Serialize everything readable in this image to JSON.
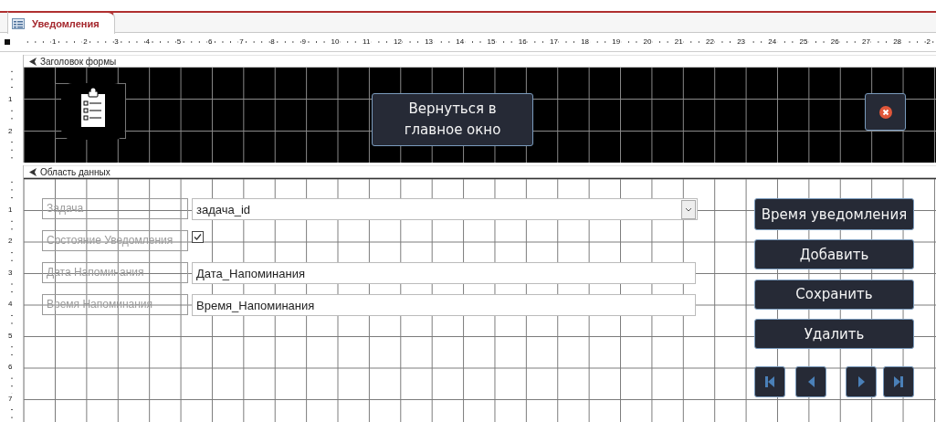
{
  "document_tab": {
    "title": "Уведомления",
    "selected": true
  },
  "ruler": {
    "horizontal": [
      "1",
      "2",
      "3",
      "4",
      "5",
      "6",
      "7",
      "8",
      "9",
      "10",
      "11",
      "12",
      "13",
      "14",
      "15",
      "16",
      "17",
      "18",
      "19",
      "20",
      "21",
      "22",
      "23",
      "24",
      "25",
      "26",
      "27",
      "28",
      "2"
    ],
    "vertical_header": [
      "1",
      "2"
    ],
    "vertical_detail": [
      "1",
      "2",
      "3",
      "4",
      "5",
      "6",
      "7"
    ]
  },
  "header": {
    "section_title": "Заголовок формы",
    "controls": [
      {
        "kind": "logo"
      },
      {
        "kind": "button",
        "label": "Вернуться в главное окно"
      },
      {
        "kind": "close"
      }
    ]
  },
  "detail": {
    "section_title": "Область данных",
    "fields": [
      {
        "kind": "combo",
        "label": "Задача",
        "value": "задача_id"
      },
      {
        "kind": "checkbox",
        "label": "Состояние Уведомления",
        "checked": true
      },
      {
        "kind": "text",
        "label": "Дата Напоминания",
        "value": "Дата_Напоминания"
      },
      {
        "kind": "text",
        "label": "Время Напоминания",
        "value": "Время_Напоминания"
      }
    ],
    "buttons": [
      "Время уведомления",
      "Добавить",
      "Сохранить",
      "Удалить"
    ],
    "navigation": [
      {
        "kind": "first"
      },
      {
        "kind": "previous"
      },
      {
        "kind": "next"
      },
      {
        "kind": "last"
      }
    ]
  }
}
